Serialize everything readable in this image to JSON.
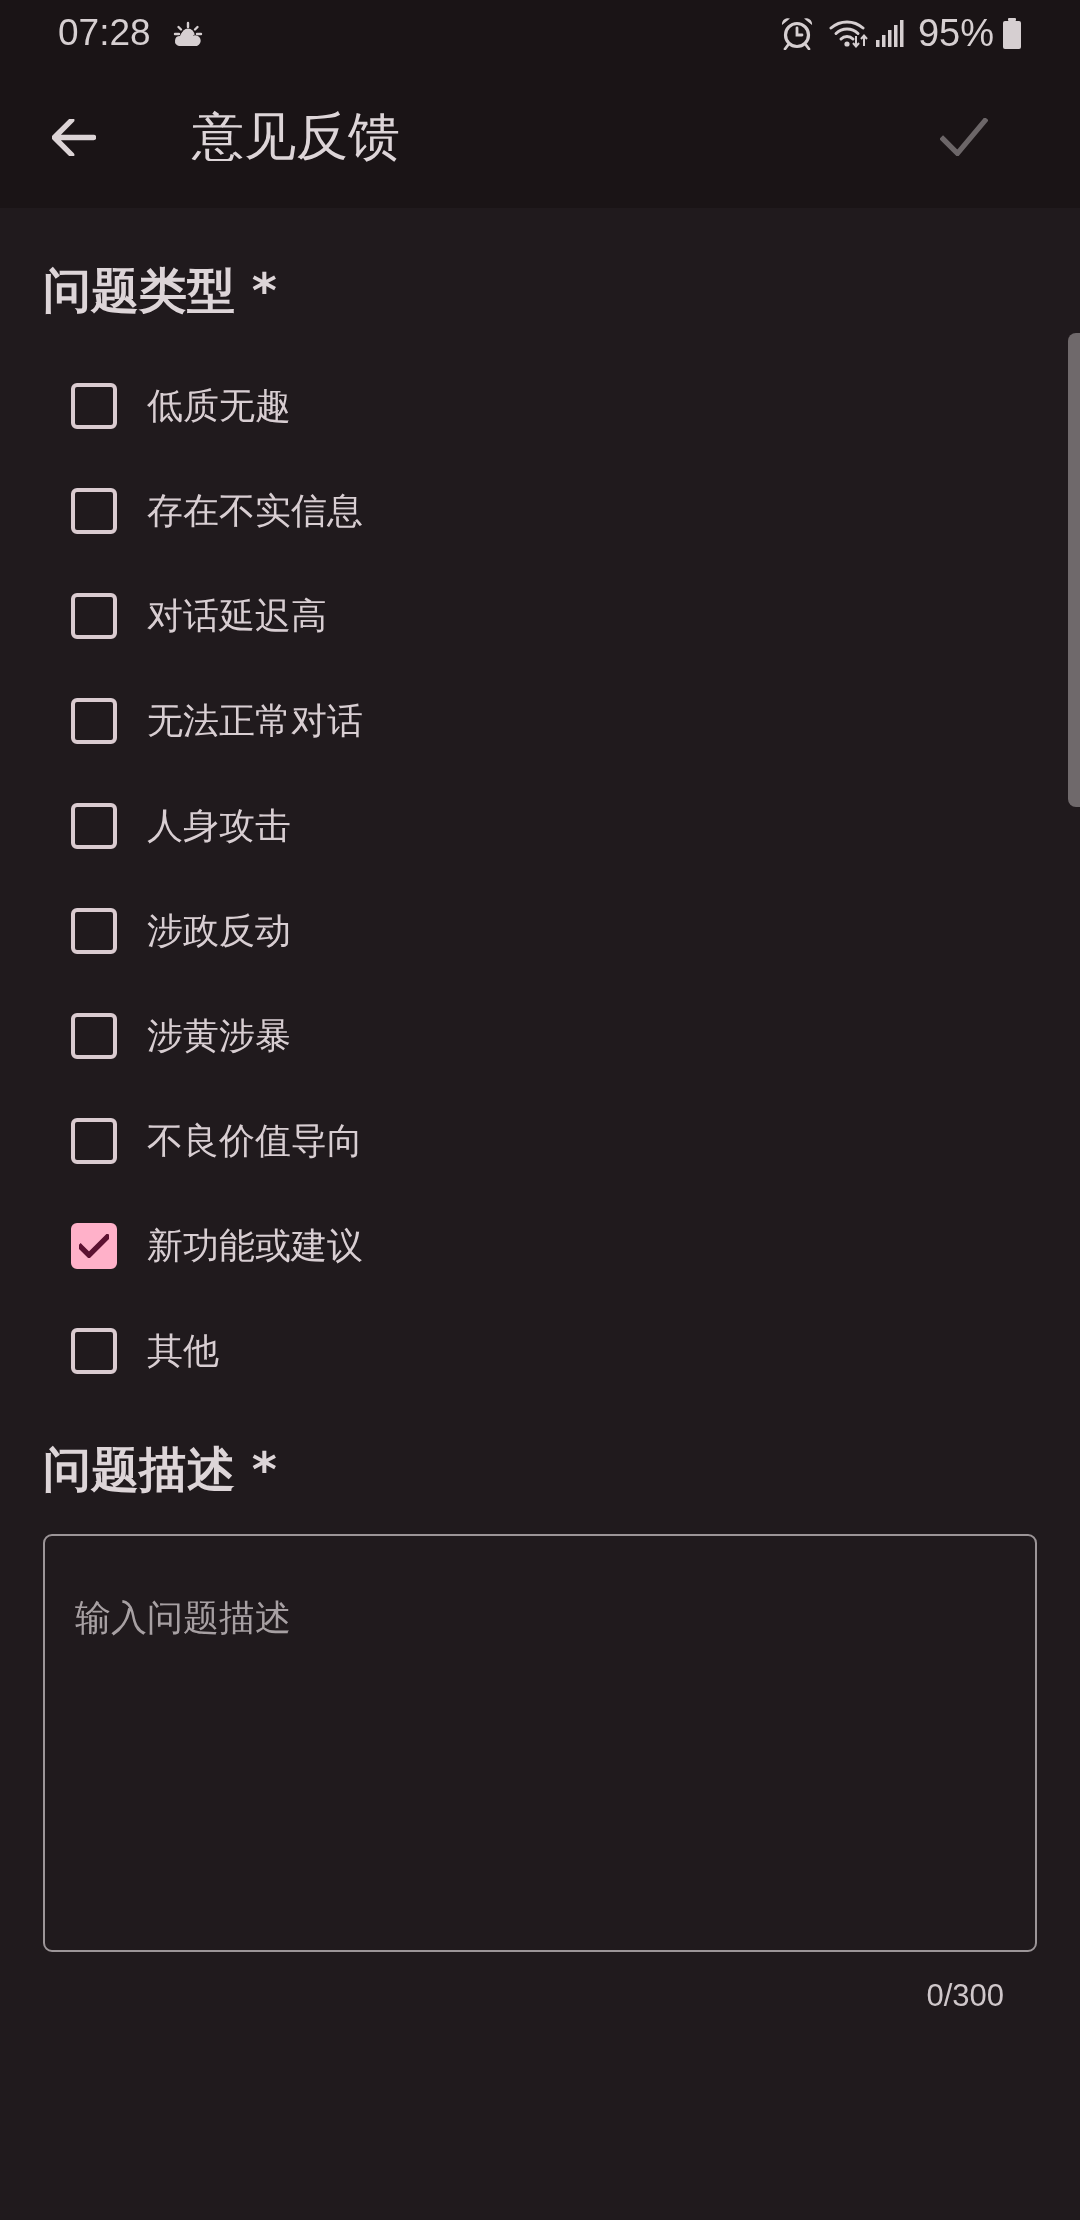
{
  "status_bar": {
    "time": "07:28",
    "battery": "95%"
  },
  "app_bar": {
    "title": "意见反馈",
    "submit": {
      "disabled": true
    }
  },
  "issue_type": {
    "title": "问题类型 *",
    "options": [
      {
        "label": "低质无趣",
        "checked": false
      },
      {
        "label": "存在不实信息",
        "checked": false
      },
      {
        "label": "对话延迟高",
        "checked": false
      },
      {
        "label": "无法正常对话",
        "checked": false
      },
      {
        "label": "人身攻击",
        "checked": false
      },
      {
        "label": "涉政反动",
        "checked": false
      },
      {
        "label": "涉黄涉暴",
        "checked": false
      },
      {
        "label": "不良价值导向",
        "checked": false
      },
      {
        "label": "新功能或建议",
        "checked": true
      },
      {
        "label": "其他",
        "checked": false
      }
    ]
  },
  "description": {
    "title": "问题描述 *",
    "placeholder": "输入问题描述",
    "counter": "0/300"
  }
}
